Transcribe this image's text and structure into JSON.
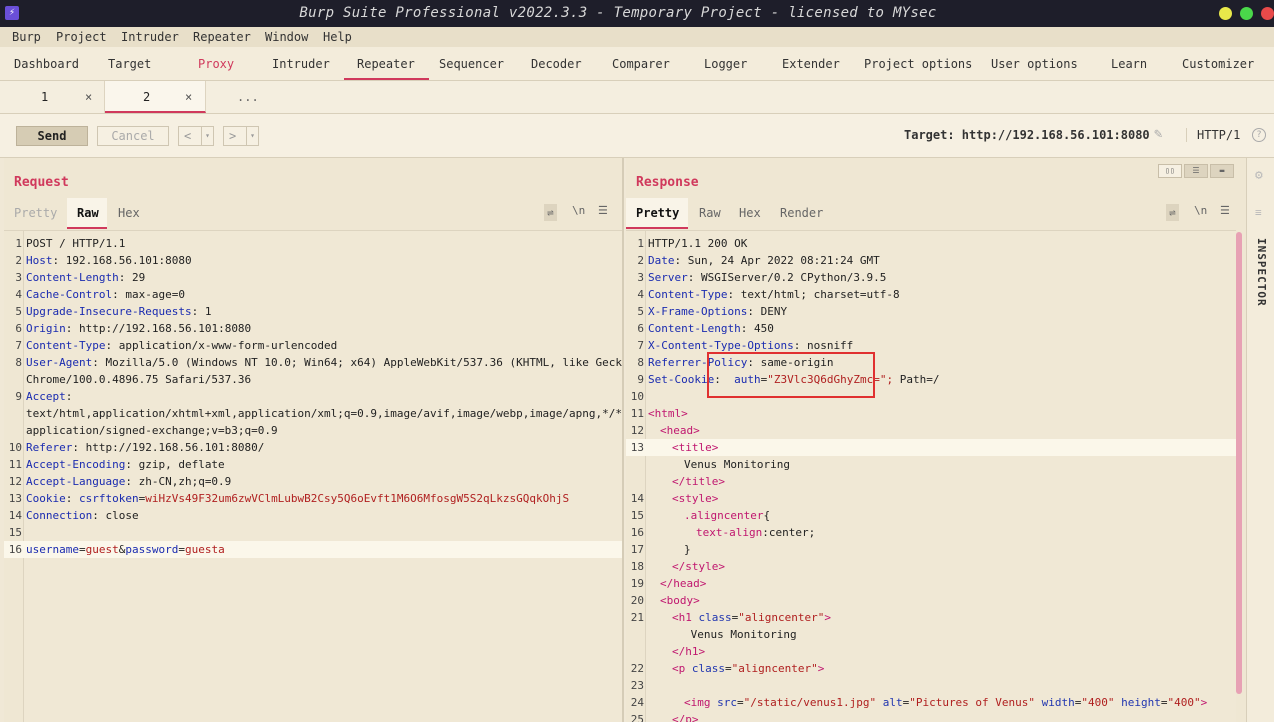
{
  "window": {
    "title": "Burp Suite Professional v2022.3.3 - Temporary Project - licensed to MYsec",
    "controls": [
      "minimize",
      "maximize",
      "close"
    ]
  },
  "menu": [
    "Burp",
    "Project",
    "Intruder",
    "Repeater",
    "Window",
    "Help"
  ],
  "top_tabs": [
    "Dashboard",
    "Target",
    "Proxy",
    "Intruder",
    "Repeater",
    "Sequencer",
    "Decoder",
    "Comparer",
    "Logger",
    "Extender",
    "Project options",
    "User options",
    "Learn",
    "Customizer"
  ],
  "repeater_tabs": [
    {
      "label": "1",
      "close": "×"
    },
    {
      "label": "2",
      "close": "×"
    },
    {
      "label": "..."
    }
  ],
  "toolbar": {
    "send": "Send",
    "cancel": "Cancel",
    "prev": "<",
    "next": ">",
    "dropdown": "▾",
    "target": "Target: http://192.168.56.101:8080",
    "http_version": "HTTP/1",
    "help": "?"
  },
  "request": {
    "title": "Request",
    "tabs": [
      "Pretty",
      "Raw",
      "Hex"
    ],
    "icons": [
      "wrap-icon",
      "newline-icon",
      "menu-icon"
    ],
    "newline_label": "\\n",
    "lines": [
      {
        "n": "1",
        "k": "POST / HTTP/1.1",
        "v": ""
      },
      {
        "n": "2",
        "k": "Host",
        "v": ": 192.168.56.101:8080"
      },
      {
        "n": "3",
        "k": "Content-Length",
        "v": ": 29"
      },
      {
        "n": "4",
        "k": "Cache-Control",
        "v": ": max-age=0"
      },
      {
        "n": "5",
        "k": "Upgrade-Insecure-Requests",
        "v": ": 1"
      },
      {
        "n": "6",
        "k": "Origin",
        "v": ": http://192.168.56.101:8080"
      },
      {
        "n": "7",
        "k": "Content-Type",
        "v": ": application/x-www-form-urlencoded"
      },
      {
        "n": "8",
        "k": "User-Agent",
        "v": ": Mozilla/5.0 (Windows NT 10.0; Win64; x64) AppleWebKit/537.36 (KHTML, like Gecko)"
      },
      {
        "n": "",
        "k": "",
        "v": "Chrome/100.0.4896.75 Safari/537.36"
      },
      {
        "n": "9",
        "k": "Accept",
        "v": ":"
      },
      {
        "n": "",
        "k": "",
        "v": "text/html,application/xhtml+xml,application/xml;q=0.9,image/avif,image/webp,image/apng,*/*;q=0.8,"
      },
      {
        "n": "",
        "k": "",
        "v": "application/signed-exchange;v=b3;q=0.9"
      },
      {
        "n": "10",
        "k": "Referer",
        "v": ": http://192.168.56.101:8080/"
      },
      {
        "n": "11",
        "k": "Accept-Encoding",
        "v": ": gzip, deflate"
      },
      {
        "n": "12",
        "k": "Accept-Language",
        "v": ": zh-CN,zh;q=0.9"
      },
      {
        "n": "13",
        "k": "Cookie",
        "v": ": "
      },
      {
        "n": "14",
        "k": "Connection",
        "v": ": close"
      },
      {
        "n": "15",
        "k": "",
        "v": ""
      },
      {
        "n": "16",
        "k": "",
        "v": ""
      }
    ],
    "cookie_name": "csrftoken",
    "cookie_value": "wiHzVs49F32um6zwVClmLubwB2Csy5Q6oEvft1M6O6MfosgW5S2qLkzsGQqkOhjS",
    "body": {
      "k1": "username",
      "v1": "guest",
      "amp": "&",
      "k2": "password",
      "v2": "guesta",
      "eq": "="
    }
  },
  "response": {
    "title": "Response",
    "tabs": [
      "Pretty",
      "Raw",
      "Hex",
      "Render"
    ],
    "headers": [
      {
        "n": "1",
        "k": "HTTP/1.1 200 OK",
        "v": ""
      },
      {
        "n": "2",
        "k": "Date",
        "v": ": Sun, 24 Apr 2022 08:21:24 GMT"
      },
      {
        "n": "3",
        "k": "Server",
        "v": ": WSGIServer/0.2 CPython/3.9.5"
      },
      {
        "n": "4",
        "k": "Content-Type",
        "v": ": text/html; charset=utf-8"
      },
      {
        "n": "5",
        "k": "X-Frame-Options",
        "v": ": DENY"
      },
      {
        "n": "6",
        "k": "Content-Length",
        "v": ": 450"
      },
      {
        "n": "7",
        "k": "X-Content-Type-Options",
        "v": ": nosniff"
      },
      {
        "n": "8",
        "k": "Referrer-Policy",
        "v": ": same-origin"
      }
    ],
    "set_cookie": {
      "n": "9",
      "k": "Set-Cookie",
      "colon": ":  ",
      "name": "auth",
      "eq": "=",
      "value": "\"Z3Vlc3Q6dGhyZmc=\";",
      "rest": " Path=/"
    },
    "html": [
      {
        "n": "10",
        "indent": 0,
        "parts": []
      },
      {
        "n": "11",
        "indent": 0,
        "parts": [
          [
            "t",
            "<html>"
          ]
        ]
      },
      {
        "n": "12",
        "indent": 1,
        "parts": [
          [
            "t",
            "<head>"
          ]
        ]
      },
      {
        "n": "13",
        "indent": 2,
        "parts": [
          [
            "t",
            "<title>"
          ]
        ]
      },
      {
        "n": "",
        "indent": 3,
        "parts": [
          [
            "p",
            "Venus Monitoring"
          ]
        ]
      },
      {
        "n": "",
        "indent": 2,
        "parts": [
          [
            "t",
            "</title>"
          ]
        ]
      },
      {
        "n": "14",
        "indent": 2,
        "parts": [
          [
            "t",
            "<style>"
          ]
        ]
      },
      {
        "n": "15",
        "indent": 3,
        "parts": [
          [
            "t",
            ".aligncenter"
          ],
          [
            "p",
            "{"
          ]
        ]
      },
      {
        "n": "16",
        "indent": 4,
        "parts": [
          [
            "t",
            "text-align"
          ],
          [
            "p",
            ":center;"
          ]
        ]
      },
      {
        "n": "17",
        "indent": 3,
        "parts": [
          [
            "p",
            "}"
          ]
        ]
      },
      {
        "n": "18",
        "indent": 2,
        "parts": [
          [
            "t",
            "</style>"
          ]
        ]
      },
      {
        "n": "19",
        "indent": 1,
        "parts": [
          [
            "t",
            "</head>"
          ]
        ]
      },
      {
        "n": "20",
        "indent": 1,
        "parts": [
          [
            "t",
            "<body>"
          ]
        ]
      },
      {
        "n": "21",
        "indent": 2,
        "parts": [
          [
            "t",
            "<h1 "
          ],
          [
            "a",
            "class"
          ],
          [
            "p",
            "="
          ],
          [
            "s",
            "\"aligncenter\""
          ],
          [
            "t",
            ">"
          ]
        ]
      },
      {
        "n": "",
        "indent": 3,
        "parts": [
          [
            "p",
            " Venus Monitoring"
          ]
        ]
      },
      {
        "n": "",
        "indent": 2,
        "parts": [
          [
            "t",
            "</h1>"
          ]
        ]
      },
      {
        "n": "22",
        "indent": 2,
        "parts": [
          [
            "t",
            "<p "
          ],
          [
            "a",
            "class"
          ],
          [
            "p",
            "="
          ],
          [
            "s",
            "\"aligncenter\""
          ],
          [
            "t",
            ">"
          ]
        ]
      },
      {
        "n": "23",
        "indent": 0,
        "parts": []
      },
      {
        "n": "24",
        "indent": 3,
        "parts": [
          [
            "t",
            "<img "
          ],
          [
            "a",
            "src"
          ],
          [
            "p",
            "="
          ],
          [
            "s",
            "\"/static/venus1.jpg\""
          ],
          [
            "p",
            " "
          ],
          [
            "a",
            "alt"
          ],
          [
            "p",
            "="
          ],
          [
            "s",
            "\"Pictures of Venus\""
          ],
          [
            "p",
            " "
          ],
          [
            "a",
            "width"
          ],
          [
            "p",
            "="
          ],
          [
            "s",
            "\"400\""
          ],
          [
            "p",
            " "
          ],
          [
            "a",
            "height"
          ],
          [
            "p",
            "="
          ],
          [
            "s",
            "\"400\""
          ],
          [
            "t",
            ">"
          ]
        ]
      },
      {
        "n": "25",
        "indent": 2,
        "parts": [
          [
            "t",
            "</p>"
          ]
        ]
      }
    ]
  },
  "inspector": {
    "label": "INSPECTOR"
  },
  "colors": {
    "accent": "#d0395c",
    "header_key": "#1a2bb0",
    "value_red": "#b02020",
    "highlight_box": "#e03030"
  }
}
